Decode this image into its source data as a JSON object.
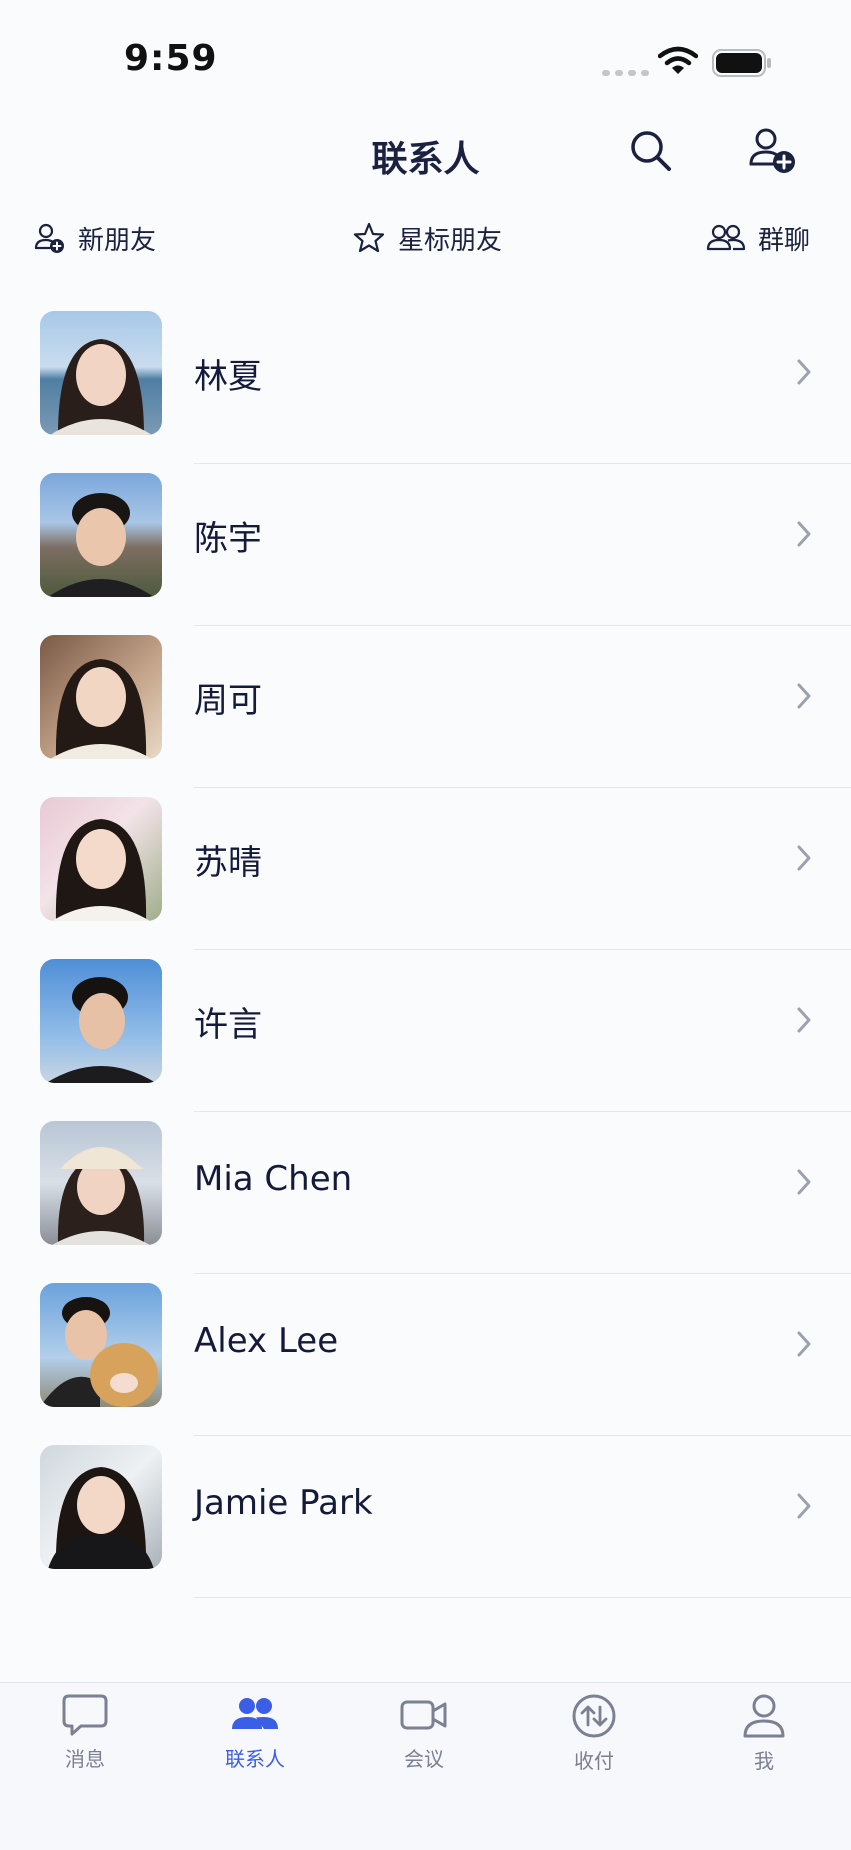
{
  "status_bar": {
    "time": "9:59"
  },
  "header": {
    "title": "联系人"
  },
  "shortcuts": {
    "new_friends": "新朋友",
    "starred_friends": "星标朋友",
    "group_chats": "群聊"
  },
  "contacts": [
    {
      "name": "林夏"
    },
    {
      "name": "陈宇"
    },
    {
      "name": "周可"
    },
    {
      "name": "苏晴"
    },
    {
      "name": "许言"
    },
    {
      "name": "Mia Chen"
    },
    {
      "name": "Alex Lee"
    },
    {
      "name": "Jamie Park"
    }
  ],
  "tab_bar": {
    "active": "contacts",
    "messages": "消息",
    "contacts": "联系人",
    "meetings": "会议",
    "payments": "收付",
    "me": "我"
  },
  "colors": {
    "accent": "#3a5ee6",
    "text": "#1b2240",
    "muted": "#7b8193"
  }
}
